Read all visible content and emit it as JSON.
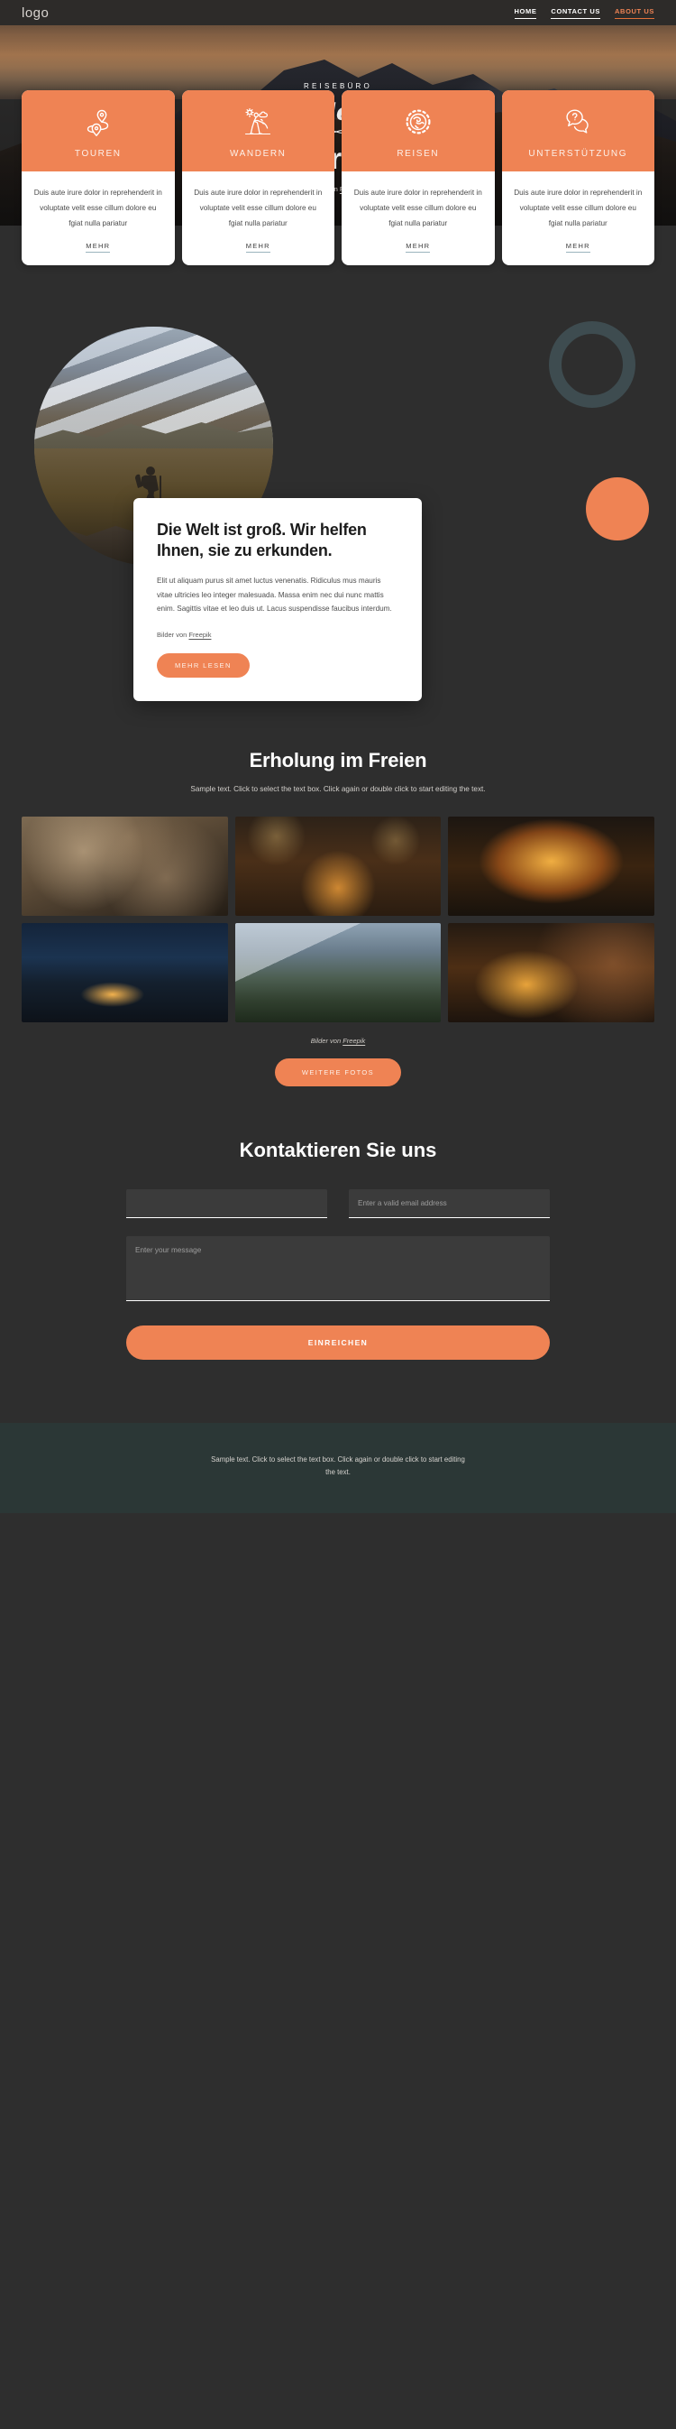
{
  "header": {
    "logo": "logo",
    "nav": [
      {
        "label": "HOME",
        "active": false
      },
      {
        "label": "CONTACT US",
        "active": false
      },
      {
        "label": "ABOUT US",
        "active": true
      }
    ]
  },
  "hero": {
    "eyebrow": "REISEBÜRO",
    "script": "Wanderlust",
    "title": "Über uns",
    "credit_prefix": "Bild von ",
    "credit_link": "Freepik"
  },
  "cards": [
    {
      "icon": "map-pins-icon",
      "title": "TOUREN",
      "text": "Duis aute irure dolor in reprehenderit in voluptate velit esse cillum dolore eu fgiat nulla pariatur",
      "more": "MEHR"
    },
    {
      "icon": "hiker-icon",
      "title": "WANDERN",
      "text": "Duis aute irure dolor in reprehenderit in voluptate velit esse cillum dolore eu fgiat nulla pariatur",
      "more": "MEHR"
    },
    {
      "icon": "globe-icon",
      "title": "REISEN",
      "text": "Duis aute irure dolor in reprehenderit in voluptate velit esse cillum dolore eu fgiat nulla pariatur",
      "more": "MEHR"
    },
    {
      "icon": "chat-question-icon",
      "title": "UNTERSTÜTZUNG",
      "text": "Duis aute irure dolor in reprehenderit in voluptate velit esse cillum dolore eu fgiat nulla pariatur",
      "more": "MEHR"
    }
  ],
  "about": {
    "title": "Die Welt ist groß. Wir helfen Ihnen, sie zu erkunden.",
    "text": "Elit ut aliquam purus sit amet luctus venenatis. Ridiculus mus mauris vitae ultricies leo integer malesuada. Massa enim nec dui nunc mattis enim. Sagittis vitae et leo duis ut. Lacus suspendisse faucibus interdum.",
    "credit_prefix": "Bilder von ",
    "credit_link": "Freepik",
    "button": "MEHR LESEN"
  },
  "gallery": {
    "title": "Erholung im Freien",
    "subtitle": "Sample text. Click to select the text box. Click again or double click to start editing the text.",
    "credit_prefix": "Bilder von ",
    "credit_link": "Freepik",
    "button": "WEITERE FOTOS"
  },
  "contact": {
    "title": "Kontaktieren Sie uns",
    "name_value": "",
    "name_placeholder": "",
    "email_value": "",
    "email_placeholder": "Enter a valid email address",
    "message_value": "",
    "message_placeholder": "Enter your message",
    "submit": "EINREICHEN"
  },
  "footer": {
    "text": "Sample text. Click to select the text box. Click again or double click to start editing the text."
  },
  "colors": {
    "accent": "#ef8354",
    "dark": "#2e2e2e",
    "header": "#2d2b29",
    "footer": "#2b3736",
    "ring": "#3e4c50"
  }
}
